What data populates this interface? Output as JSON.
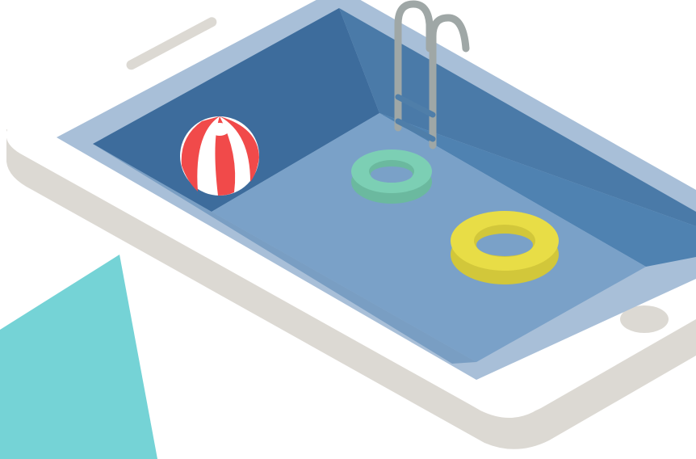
{
  "colors": {
    "background": "#ffffff",
    "accent_shape": "#75d3d6",
    "phone_body": "#ffffff",
    "phone_edge": "#dcd9d3",
    "pool_rim": "#a8bfd8",
    "pool_inner_wall": "#4a7aa8",
    "pool_wall_dark": "#3d6c9c",
    "pool_floor": "#7aa1c8",
    "ladder": "#9fa7a6",
    "ball_red": "#f14a4a",
    "ball_white": "#ffffff",
    "ring_green": "#7ccfb4",
    "ring_yellow": "#e8dd46"
  },
  "icons": [
    "smartphone-pool-illustration",
    "beach-ball-icon",
    "swim-ring-icon",
    "pool-ladder-icon",
    "home-button-icon",
    "speaker-slot-icon"
  ]
}
